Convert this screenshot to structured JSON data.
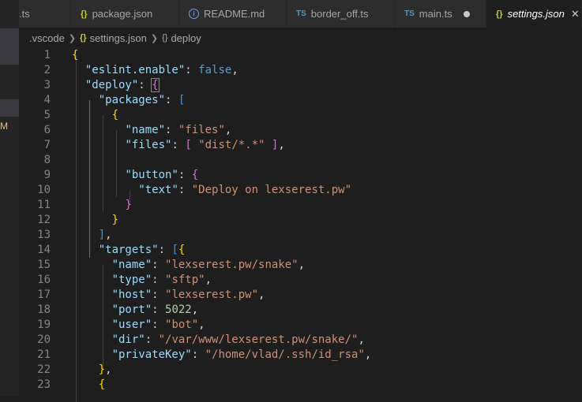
{
  "tabs": [
    {
      "icon": "none",
      "label": ".ts"
    },
    {
      "icon": "json",
      "label": "package.json"
    },
    {
      "icon": "info",
      "label": "README.md"
    },
    {
      "icon": "ts",
      "label": "border_off.ts"
    },
    {
      "icon": "ts",
      "label": "main.ts",
      "modified": true
    },
    {
      "icon": "json",
      "label": "settings.json",
      "active": true,
      "closable": true
    }
  ],
  "breadcrumb": [
    ".vscode",
    "settings.json",
    "deploy"
  ],
  "sidebar": {
    "m_badge": "M"
  },
  "icons": {
    "json": "{}",
    "ts": "TS",
    "info": "i",
    "close": "✕"
  },
  "code_lines": [
    {
      "n": "1",
      "t": [
        [
          "y",
          "{"
        ]
      ]
    },
    {
      "n": "2",
      "t": [
        [
          "p",
          "  "
        ],
        [
          "k",
          "\"eslint.enable\""
        ],
        [
          "p",
          ": "
        ],
        [
          "b",
          "false"
        ],
        [
          "p",
          ","
        ]
      ]
    },
    {
      "n": "3",
      "t": [
        [
          "p",
          "  "
        ],
        [
          "k",
          "\"deploy\""
        ],
        [
          "p",
          ": "
        ],
        [
          "m",
          "{"
        ]
      ]
    },
    {
      "n": "4",
      "t": [
        [
          "p",
          "    "
        ],
        [
          "k",
          "\"packages\""
        ],
        [
          "p",
          ": "
        ],
        [
          "c",
          "["
        ]
      ]
    },
    {
      "n": "5",
      "t": [
        [
          "p",
          "      "
        ],
        [
          "y",
          "{"
        ]
      ]
    },
    {
      "n": "6",
      "t": [
        [
          "p",
          "        "
        ],
        [
          "k",
          "\"name\""
        ],
        [
          "p",
          ": "
        ],
        [
          "s",
          "\"files\""
        ],
        [
          "p",
          ","
        ]
      ]
    },
    {
      "n": "7",
      "t": [
        [
          "p",
          "        "
        ],
        [
          "k",
          "\"files\""
        ],
        [
          "p",
          ": "
        ],
        [
          "m",
          "["
        ],
        [
          "p",
          " "
        ],
        [
          "s",
          "\"dist/*.*\""
        ],
        [
          "p",
          " "
        ],
        [
          "m",
          "]"
        ],
        [
          "p",
          ","
        ]
      ]
    },
    {
      "n": "8",
      "t": []
    },
    {
      "n": "9",
      "t": [
        [
          "p",
          "        "
        ],
        [
          "k",
          "\"button\""
        ],
        [
          "p",
          ": "
        ],
        [
          "m",
          "{"
        ]
      ]
    },
    {
      "n": "10",
      "t": [
        [
          "p",
          "          "
        ],
        [
          "k",
          "\"text\""
        ],
        [
          "p",
          ": "
        ],
        [
          "s",
          "\"Deploy on lexserest.pw\""
        ]
      ]
    },
    {
      "n": "11",
      "t": [
        [
          "p",
          "        "
        ],
        [
          "m",
          "}"
        ]
      ]
    },
    {
      "n": "12",
      "t": [
        [
          "p",
          "      "
        ],
        [
          "y",
          "}"
        ]
      ]
    },
    {
      "n": "13",
      "t": [
        [
          "p",
          "    "
        ],
        [
          "c",
          "]"
        ],
        [
          "p",
          ","
        ]
      ]
    },
    {
      "n": "14",
      "t": [
        [
          "p",
          "    "
        ],
        [
          "k",
          "\"targets\""
        ],
        [
          "p",
          ": "
        ],
        [
          "c",
          "["
        ],
        [
          "y",
          "{"
        ]
      ]
    },
    {
      "n": "15",
      "t": [
        [
          "p",
          "      "
        ],
        [
          "k",
          "\"name\""
        ],
        [
          "p",
          ": "
        ],
        [
          "s",
          "\"lexserest.pw/snake\""
        ],
        [
          "p",
          ","
        ]
      ]
    },
    {
      "n": "16",
      "t": [
        [
          "p",
          "      "
        ],
        [
          "k",
          "\"type\""
        ],
        [
          "p",
          ": "
        ],
        [
          "s",
          "\"sftp\""
        ],
        [
          "p",
          ","
        ]
      ]
    },
    {
      "n": "17",
      "t": [
        [
          "p",
          "      "
        ],
        [
          "k",
          "\"host\""
        ],
        [
          "p",
          ": "
        ],
        [
          "s",
          "\"lexserest.pw\""
        ],
        [
          "p",
          ","
        ]
      ]
    },
    {
      "n": "18",
      "t": [
        [
          "p",
          "      "
        ],
        [
          "k",
          "\"port\""
        ],
        [
          "p",
          ": "
        ],
        [
          "n",
          "5022"
        ],
        [
          "p",
          ","
        ]
      ]
    },
    {
      "n": "19",
      "t": [
        [
          "p",
          "      "
        ],
        [
          "k",
          "\"user\""
        ],
        [
          "p",
          ": "
        ],
        [
          "s",
          "\"bot\""
        ],
        [
          "p",
          ","
        ]
      ]
    },
    {
      "n": "20",
      "t": [
        [
          "p",
          "      "
        ],
        [
          "k",
          "\"dir\""
        ],
        [
          "p",
          ": "
        ],
        [
          "s",
          "\"/var/www/lexserest.pw/snake/\""
        ],
        [
          "p",
          ","
        ]
      ]
    },
    {
      "n": "21",
      "t": [
        [
          "p",
          "      "
        ],
        [
          "k",
          "\"privateKey\""
        ],
        [
          "p",
          ": "
        ],
        [
          "s",
          "\"/home/vlad/.ssh/id_rsa\""
        ],
        [
          "p",
          ","
        ]
      ]
    },
    {
      "n": "22",
      "t": [
        [
          "p",
          "    "
        ],
        [
          "y",
          "}"
        ],
        [
          "p",
          ","
        ]
      ]
    },
    {
      "n": "23",
      "t": [
        [
          "p",
          "    "
        ],
        [
          "y",
          "{"
        ]
      ]
    }
  ]
}
